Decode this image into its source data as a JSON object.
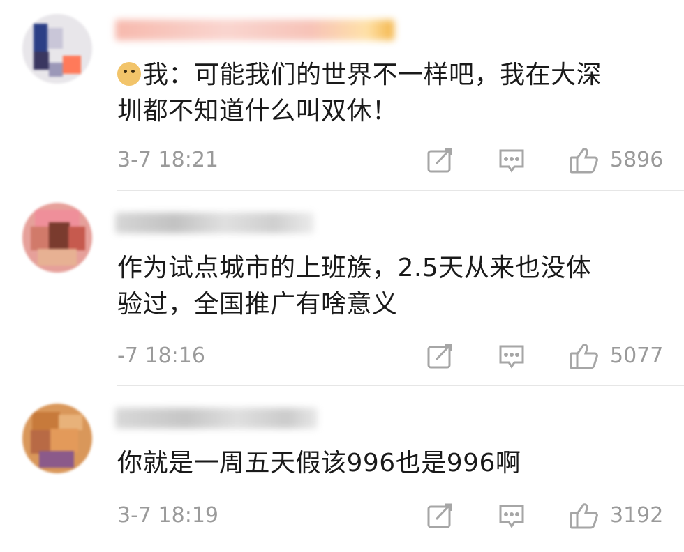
{
  "comments": [
    {
      "prefix": "我：",
      "text_line1": "可能我们的世界不一样吧，我在大深",
      "text_line2": "圳都不知道什么叫双休！",
      "time": "3-7 18:21",
      "likes": "5896",
      "has_emoji": true
    },
    {
      "text_line1": "作为试点城市的上班族，2.5天从来也没体",
      "text_line2": "验过，全国推广有啥意义",
      "time": "-7 18:16",
      "likes": "5077"
    },
    {
      "text_line1": "你就是一周五天假该996也是996啊",
      "time": "3-7 18:19",
      "likes": "3192"
    }
  ],
  "icons": {
    "share": "share-icon",
    "reply": "comment-icon",
    "like": "thumbs-up-icon"
  },
  "colors": {
    "text": "#1a1a1a",
    "meta": "#9a9a9a",
    "divider": "#e6e6e6"
  }
}
